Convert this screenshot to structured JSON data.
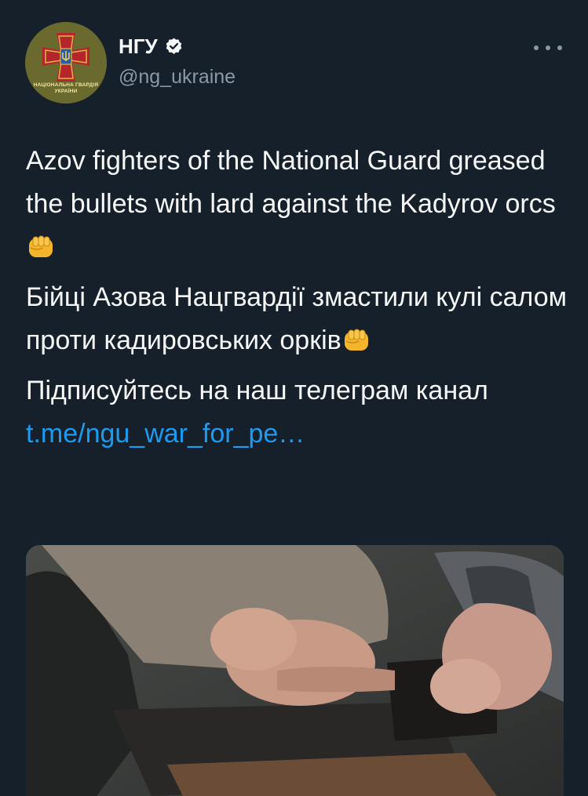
{
  "account": {
    "display_name": "НГУ",
    "handle": "@ng_ukraine",
    "avatar_text_line1": "НАЦІОНАЛЬНА ГВАРДІЯ",
    "avatar_text_line2": "УКРАЇНИ"
  },
  "tweet": {
    "paragraph1": "Azov fighters of the National Guard greased the bullets with lard against the Kadyrov orcs",
    "paragraph2": "Бійці Азова Нацгвардії змастили кулі салом проти кадировських орків",
    "paragraph3_text": "Підписуйтесь на наш телеграм канал ",
    "paragraph3_link": "t.me/ngu_war_for_pe…"
  },
  "icons": {
    "verified": "verified-badge-icon",
    "more": "more-options-icon",
    "emoji": "oncoming-fist-emoji"
  },
  "colors": {
    "background": "#15202b",
    "text": "#f7f9f9",
    "secondary": "#8b98a5",
    "link": "#1d9bf0"
  }
}
